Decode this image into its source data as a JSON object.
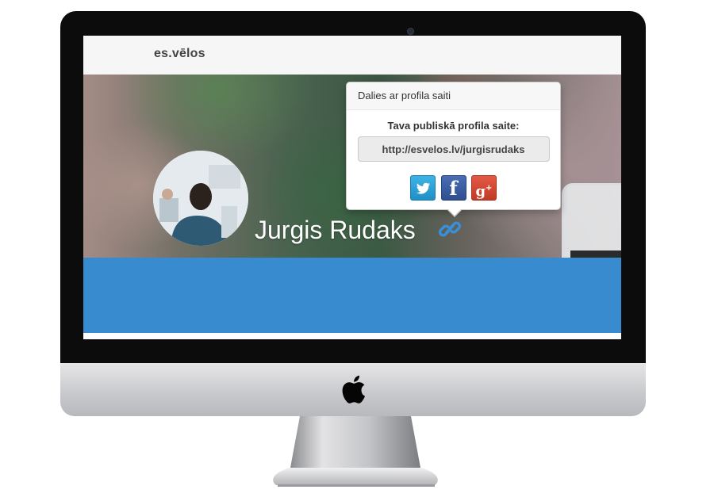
{
  "navbar": {
    "brand": "es.vēlos"
  },
  "profile": {
    "name": "Jurgis Rudaks"
  },
  "share_popover": {
    "title": "Dalies ar profila saiti",
    "heading": "Tava publiskā profila saite:",
    "url": "http://esvelos.lv/jurgisrudaks",
    "buttons": [
      {
        "network": "Twitter",
        "icon": "twitter-icon",
        "color": "#1da1f2"
      },
      {
        "network": "Facebook",
        "icon": "facebook-icon",
        "color": "#3b5998"
      },
      {
        "network": "Google+",
        "icon": "google-plus-icon",
        "color": "#dd4b39"
      }
    ]
  },
  "colors": {
    "band": "#388bce",
    "link_icon": "#3a8fd9"
  }
}
